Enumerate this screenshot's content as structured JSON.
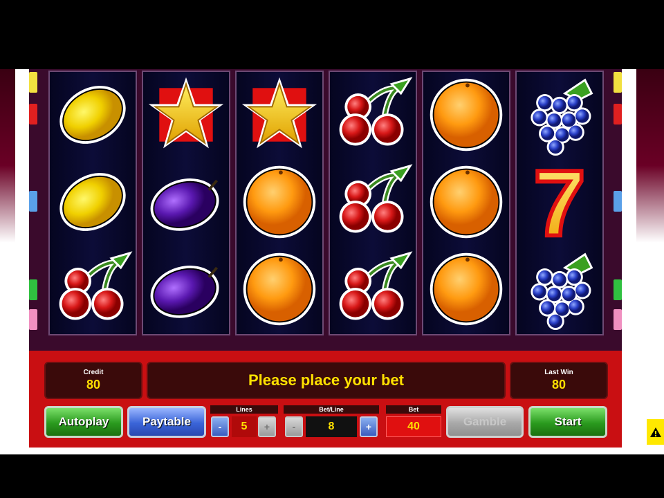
{
  "info": {
    "credit_label": "Credit",
    "credit_value": "80",
    "message": "Please place your bet",
    "last_win_label": "Last Win",
    "last_win_value": "80"
  },
  "controls": {
    "autoplay_label": "Autoplay",
    "paytable_label": "Paytable",
    "lines_label": "Lines",
    "lines_value": "5",
    "bet_line_label": "Bet/Line",
    "bet_line_value": "8",
    "bet_label": "Bet",
    "bet_value": "40",
    "gamble_label": "Gamble",
    "start_label": "Start",
    "minus_glyph": "-",
    "plus_glyph": "+"
  },
  "reels": [
    [
      "lemon",
      "lemon",
      "cherries"
    ],
    [
      "star",
      "plum",
      "plum"
    ],
    [
      "star",
      "orange",
      "orange"
    ],
    [
      "cherries",
      "cherries",
      "cherries"
    ],
    [
      "orange",
      "orange",
      "orange"
    ],
    [
      "grapes",
      "seven",
      "grapes"
    ]
  ],
  "seven_text": "7",
  "corner_icon": "warning-icon",
  "colors": {
    "panel_red": "#c90f12",
    "accent_yellow": "#ffe000",
    "reel_bg": "#0c0c38"
  }
}
